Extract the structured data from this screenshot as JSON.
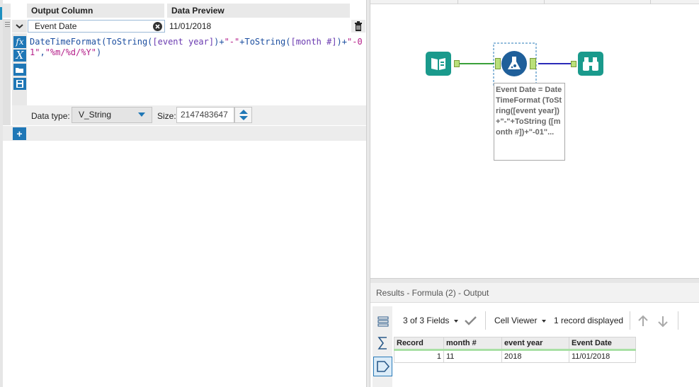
{
  "config": {
    "header": {
      "output_column": "Output Column",
      "data_preview": "Data Preview"
    },
    "row": {
      "field": "Event Date",
      "preview": "11/01/2018"
    },
    "expression": {
      "line1": [
        {
          "t": "DateTimeFormat(",
          "c": "fn"
        },
        {
          "t": "ToString(",
          "c": "fn"
        },
        {
          "t": "[event year]",
          "c": "fld"
        },
        {
          "t": ")+",
          "c": "fn"
        },
        {
          "t": "\"-\"",
          "c": "str"
        },
        {
          "t": "+",
          "c": "fn"
        },
        {
          "t": "ToString(",
          "c": "fn"
        },
        {
          "t": "[month #]",
          "c": "fld"
        },
        {
          "t": ")+",
          "c": "fn"
        },
        {
          "t": "\"-01\"",
          "c": "str"
        },
        {
          "t": ",",
          "c": "fn"
        },
        {
          "t": "\"%m/%d/%Y\"",
          "c": "str"
        },
        {
          "t": ")",
          "c": "fn"
        }
      ]
    },
    "data_type_label": "Data type:",
    "data_type_value": "V_String",
    "size_label": "Size:",
    "size_value": "2147483647",
    "tool_buttons": [
      "fx",
      "X"
    ]
  },
  "canvas": {
    "annotation": "Event Date = DateTimeFormat (ToString([event year]) +\"-\"+ToString ([month #])+\"-01\"..."
  },
  "results": {
    "title": "Results - Formula (2) - Output",
    "fields_label": "3 of 3 Fields",
    "viewer_label": "Cell Viewer",
    "records_label": "1 record displayed",
    "columns": [
      "Record",
      "month #",
      "event year",
      "Event Date"
    ],
    "rows": [
      [
        "1",
        "11",
        "2018",
        "11/01/2018"
      ]
    ]
  },
  "colors": {
    "accent": "#1f77b6",
    "teal": "#1a9a8c",
    "header_green": "#a9e0a5"
  }
}
